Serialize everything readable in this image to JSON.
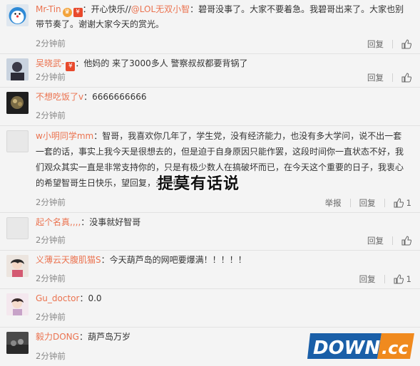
{
  "comments": [
    {
      "user": "Mr-Tin",
      "sep": "：",
      "pre": "开心快乐//",
      "mention": "@LOL无双小智",
      "text": "：碧哥没事了。大家不要着急。我碧哥出来了。大家也别带节奏了。谢谢大家今天的赏光。",
      "time": "2分钟前",
      "reply": "回复",
      "report": "",
      "likes": ""
    },
    {
      "user": "吴晓武-",
      "sep": "：",
      "text": "他妈的 来了3000多人 警察叔叔都要背锅了",
      "time": "2分钟前",
      "reply": "回复",
      "report": "",
      "likes": ""
    },
    {
      "user": "不想吃饭了v",
      "sep": "：",
      "text": "6666666666",
      "time": "2分钟前",
      "reply": "回复",
      "report": "",
      "likes": ""
    },
    {
      "user": "w小明同学mm",
      "sep": "：",
      "text": "智哥，我喜欢你几年了，学生党，没有经济能力，也没有多大学问，说不出一套一套的话，事实上我今天是很想去的，但是迫于自身原因只能作罢，这段时间你一直状态不好，我们观众其实一直是非常支持你的，只是有极少数人在搞破坏而已，在今天这个重要的日子，我衷心的希望智哥生日快乐，望回复，多久都等",
      "time": "2分钟前",
      "reply": "回复",
      "report": "举报",
      "likes": "1"
    },
    {
      "user": "起个名真,,,,",
      "sep": "：",
      "text": "没事就好智哥",
      "time": "2分钟前",
      "reply": "回复",
      "report": "",
      "likes": ""
    },
    {
      "user": "义薄云天腹肌猫S",
      "sep": "：",
      "text": "今天葫芦岛的网吧要爆满！！！！！",
      "time": "2分钟前",
      "reply": "回复",
      "report": "",
      "likes": "1"
    },
    {
      "user": "Gu_doctor",
      "sep": "：",
      "text": "0.0",
      "time": "2分钟前",
      "reply": "回复",
      "report": "",
      "likes": ""
    },
    {
      "user": "毅力DONG",
      "sep": "：",
      "text": "葫芦岛万岁",
      "time": "2分钟前",
      "reply": "回复",
      "report": "",
      "likes": ""
    }
  ],
  "watermark": "提莫有话说",
  "logo": {
    "main": "DOWN",
    "suffix": ".cc",
    "accent": "#f08a1e",
    "blue": "#1a5fa8"
  },
  "colors": {
    "username": "#eb7350",
    "bg": "#f4f4f4"
  }
}
